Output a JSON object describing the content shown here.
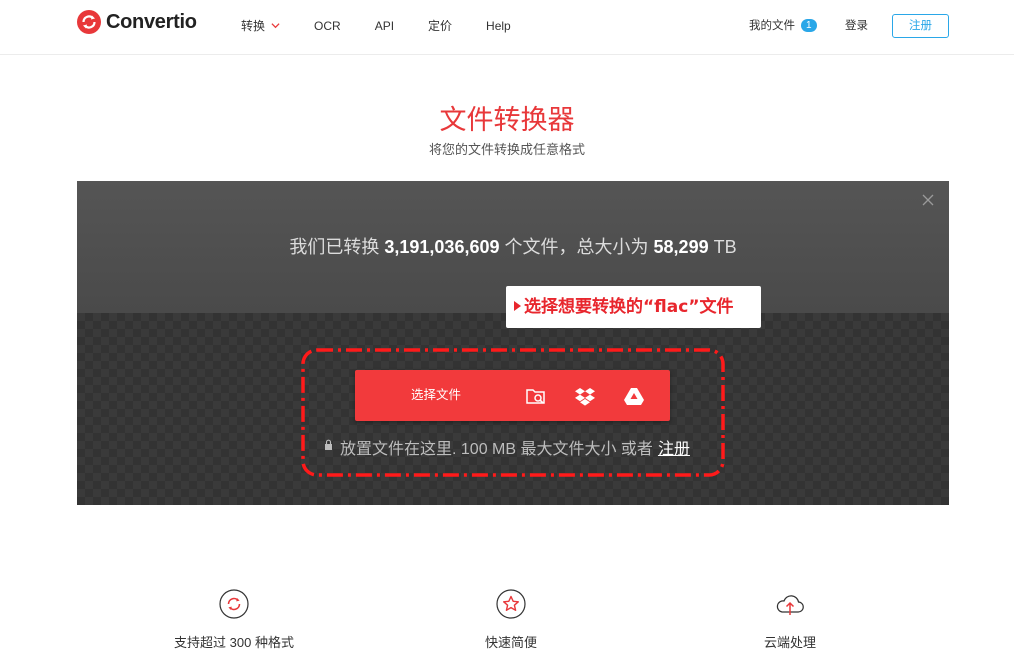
{
  "header": {
    "brand": "Convertio",
    "nav": [
      {
        "label": "转换",
        "has_dropdown": true
      },
      {
        "label": "OCR"
      },
      {
        "label": "API"
      },
      {
        "label": "定价"
      },
      {
        "label": "Help"
      }
    ],
    "my_files_label": "我的文件",
    "my_files_count": "1",
    "login_label": "登录",
    "register_label": "注册"
  },
  "hero": {
    "title": "文件转换器",
    "subtitle": "将您的文件转换成任意格式"
  },
  "panel": {
    "stats_prefix": "我们已转换",
    "files_count": "3,191,036,609",
    "stats_middle": "个文件，总大小为",
    "total_size": "58,299",
    "size_unit": "TB",
    "callout": "选择想要转换的“flac”文件",
    "choose_button": "选择文件",
    "drop_text": "放置文件在这里. 100 MB 最大文件大小 或者",
    "register_link": "注册"
  },
  "features": [
    {
      "label": "支持超过 300 种格式",
      "icon": "refresh-icon"
    },
    {
      "label": "快速简便",
      "icon": "star-icon"
    },
    {
      "label": "云端处理",
      "icon": "cloud-upload-icon"
    }
  ],
  "colors": {
    "brand_red": "#e8383a",
    "button_red": "#f23a3c",
    "accent_blue": "#2aa7e8",
    "panel_dark": "#3d3d3d"
  }
}
